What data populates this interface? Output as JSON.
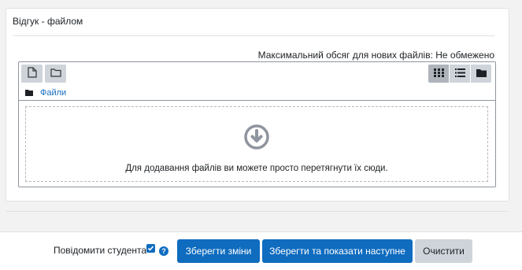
{
  "feedback": {
    "legend": "Відгук - файлом",
    "max_size_text": "Максимальний обсяг для нових файлів: Не обмежено",
    "breadcrumb_label": "Файли",
    "drop_message": "Для додавання файлів ви можете просто перетягнути їх сюди."
  },
  "footer": {
    "notify_label": "Повідомити студента",
    "notify_checked": true,
    "save_label": "Зберегти зміни",
    "save_next_label": "Зберегти та показати наступне",
    "reset_label": "Очистити"
  },
  "colors": {
    "primary": "#0f6cbf",
    "secondary": "#ced4da",
    "active_view": "#aeb4ba"
  }
}
